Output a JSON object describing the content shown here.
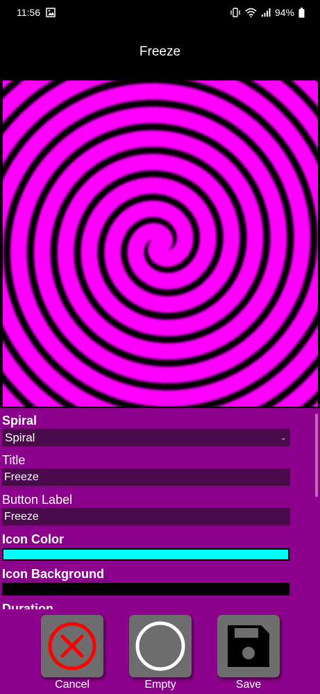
{
  "status_bar": {
    "time": "11:56",
    "battery": "94%"
  },
  "header": {
    "title": "Freeze"
  },
  "colors": {
    "spiral_primary": "#ff00ff",
    "spiral_secondary": "#000000",
    "panel_background": "#8b018b",
    "icon_color": "#00ffff",
    "icon_background": "#000000"
  },
  "form": {
    "spiral_label": "Spiral",
    "spiral_value": "Spiral",
    "title_label": "Title",
    "title_value": "Freeze",
    "button_label_label": "Button Label",
    "button_label_value": "Freeze",
    "icon_color_label": "Icon Color",
    "icon_background_label": "Icon Background",
    "duration_label": "Duration"
  },
  "actions": {
    "cancel_label": "Cancel",
    "empty_label": "Empty",
    "save_label": "Save"
  }
}
